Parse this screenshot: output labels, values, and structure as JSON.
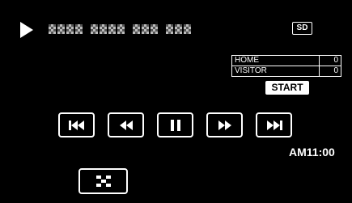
{
  "header": {
    "play_icon": "play-icon",
    "media_badge": "SD"
  },
  "scoreboard": {
    "rows": [
      {
        "team": "HOME",
        "score": "0"
      },
      {
        "team": "VISITOR",
        "score": "0"
      }
    ],
    "start_label": "START"
  },
  "controls": [
    {
      "icon": "skip-previous-icon"
    },
    {
      "icon": "rewind-icon"
    },
    {
      "icon": "pause-icon"
    },
    {
      "icon": "fast-forward-icon"
    },
    {
      "icon": "skip-next-icon"
    }
  ],
  "clock": {
    "time": "AM11:00"
  },
  "index_button": {
    "icon": "index-grid-icon"
  }
}
